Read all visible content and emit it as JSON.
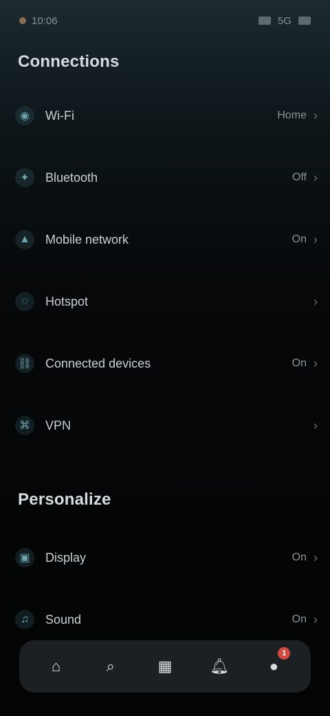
{
  "status_bar": {
    "time": "10:06",
    "signal_text": "5G"
  },
  "section_1": {
    "title": "Connections",
    "items": [
      {
        "icon": "wifi-icon",
        "label": "Wi-Fi",
        "value": "Home"
      },
      {
        "icon": "bluetooth-icon",
        "label": "Bluetooth",
        "value": "Off"
      },
      {
        "icon": "network-icon",
        "label": "Mobile network",
        "value": "On"
      },
      {
        "icon": "hotspot-icon",
        "label": "Hotspot",
        "value": ""
      },
      {
        "icon": "link-icon",
        "label": "Connected devices",
        "value": "On"
      },
      {
        "icon": "vpn-icon",
        "label": "VPN",
        "value": ""
      }
    ]
  },
  "section_2": {
    "title": "Personalize",
    "items": [
      {
        "icon": "display-icon",
        "label": "Display",
        "value": "On"
      },
      {
        "icon": "sound-icon",
        "label": "Sound",
        "value": "On"
      }
    ]
  },
  "bottom_nav": {
    "items": [
      {
        "icon": "home-icon",
        "label": "",
        "badge": ""
      },
      {
        "icon": "search-icon",
        "label": "",
        "badge": ""
      },
      {
        "icon": "apps-icon",
        "label": "",
        "badge": ""
      },
      {
        "icon": "bell-icon",
        "label": "",
        "badge": ""
      },
      {
        "icon": "profile-icon",
        "label": "",
        "badge": "1"
      }
    ]
  }
}
